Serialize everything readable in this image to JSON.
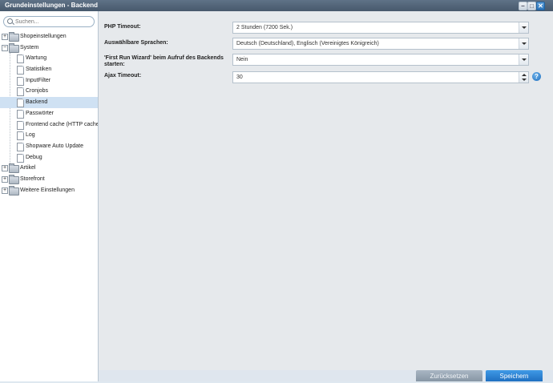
{
  "window": {
    "title": "Grundeinstellungen - Backend"
  },
  "search": {
    "placeholder": "Suchen..."
  },
  "tree": {
    "shopeinstellungen": "Shopeinstellungen",
    "system": "System",
    "wartung": "Wartung",
    "statistiken": "Statistiken",
    "inputfilter": "InputFilter",
    "cronjobs": "Cronjobs",
    "backend": "Backend",
    "passwoerter": "Passwörter",
    "frontend_cache": "Frontend cache (HTTP cache)",
    "log": "Log",
    "auto_update": "Shopware Auto Update",
    "debug": "Debug",
    "artikel": "Artikel",
    "storefront": "Storefront",
    "weitere": "Weitere Einstellungen",
    "collapsed_symbol": "+",
    "expanded_symbol": "−"
  },
  "form": {
    "php_timeout": {
      "label": "PHP Timeout:",
      "value": "2 Stunden (7200 Sek.)"
    },
    "languages": {
      "label": "Auswählbare Sprachen:",
      "value": "Deutsch (Deutschland), Englisch (Vereinigtes Königreich)"
    },
    "first_run": {
      "label_line1": "'First Run Wizard' beim Aufruf des Backends",
      "label_line2": "starten:",
      "value": "Nein"
    },
    "ajax_timeout": {
      "label": "Ajax Timeout:",
      "value": "30"
    },
    "help_symbol": "?"
  },
  "footer": {
    "reset_label": "Zurücksetzen",
    "save_label": "Speichern"
  },
  "colors": {
    "titlebar": "#4f6276",
    "selected": "#cfe1f3",
    "save": "#2b7fd3",
    "reset": "#97a5b3"
  },
  "icons": [
    "search-icon",
    "folder-icon",
    "document-icon",
    "minimize-icon",
    "maximize-icon",
    "close-icon",
    "help-icon"
  ]
}
